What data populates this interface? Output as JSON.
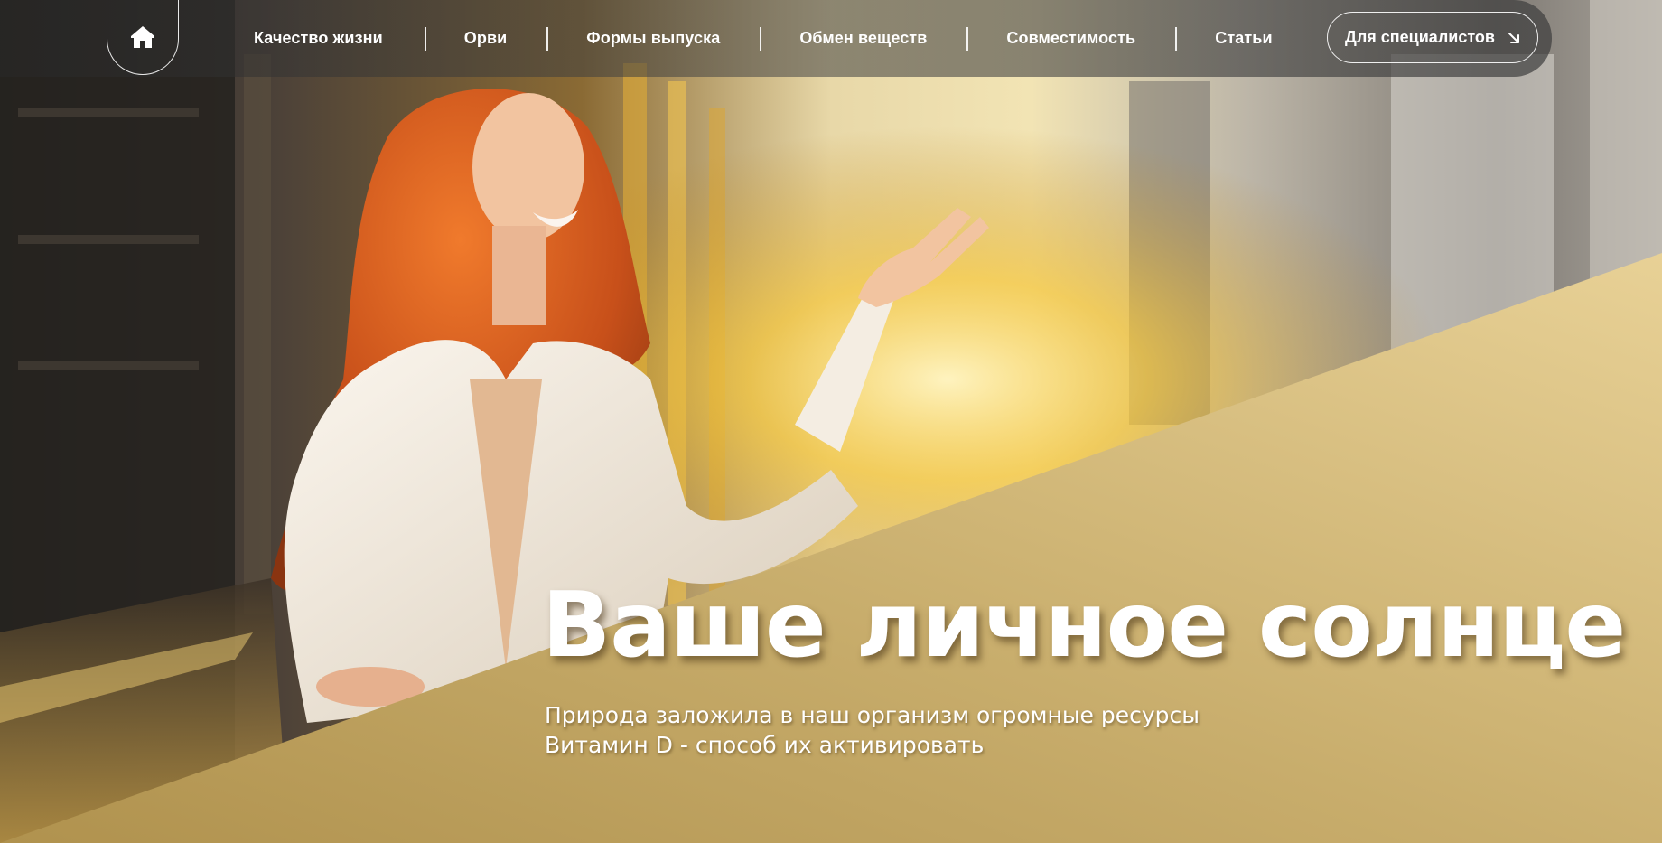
{
  "nav": {
    "home_icon": "home-icon",
    "items": [
      {
        "label": "Качество жизни"
      },
      {
        "label": "Орви"
      },
      {
        "label": "Формы выпуска"
      },
      {
        "label": "Обмен веществ"
      },
      {
        "label": "Совместимость"
      },
      {
        "label": "Статьи"
      }
    ],
    "cta": {
      "label": "Для специалистов",
      "icon": "arrow-down-right-icon"
    }
  },
  "hero": {
    "title": "Ваше личное солнце",
    "subtitle_line1": "Природа заложила в наш организм огромные ресурсы",
    "subtitle_line2": "Витамин D - способ их активировать"
  },
  "colors": {
    "gold": "#c8ad6c",
    "gold_light": "#e6cf92",
    "text": "#ffffff"
  }
}
